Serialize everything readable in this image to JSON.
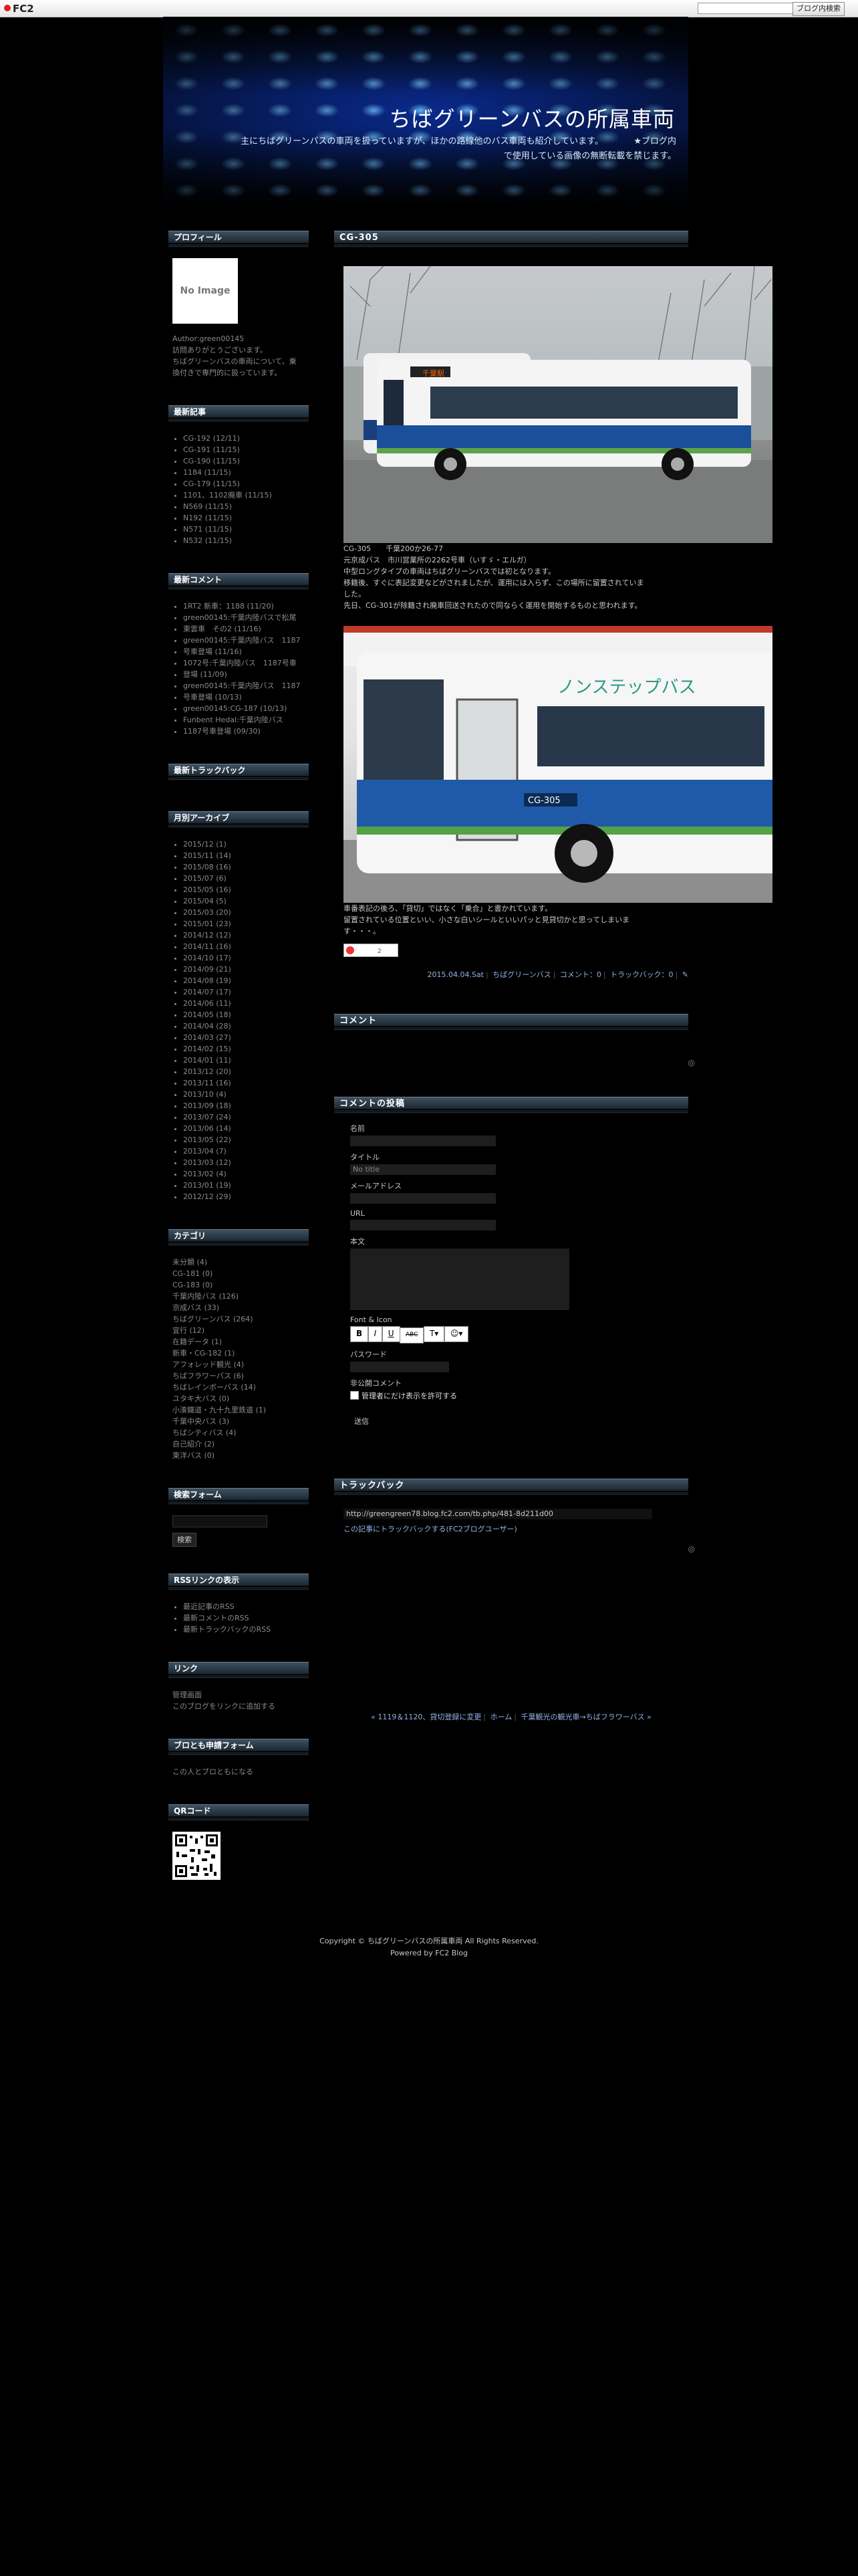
{
  "fc2bar": {
    "logo": "FC2",
    "search_button": "ブログ内検索"
  },
  "header": {
    "title": "ちばグリーンバスの所属車両",
    "desc_line1": "主にちばグリーンバスの車両を扱っていますが、ほかの路線他のバス車両も紹介しています。　　　　★ブログ内",
    "desc_line2": "で使用している画像の無断転載を禁じます。"
  },
  "sidebar": {
    "profile": {
      "title": "プロフィール",
      "image_text": "No Image",
      "author": "Author:green00145",
      "lines": [
        "訪問ありがとうございます。",
        "ちばグリーンバスの車両について、乗",
        "換付きで専門的に扱っています。"
      ]
    },
    "recent_entries": {
      "title": "最新記事",
      "items": [
        "CG-192 (12/11)",
        "CG-191 (11/15)",
        "CG-190 (11/15)",
        "1184 (11/15)",
        "CG-179 (11/15)",
        "1101、1102廃車 (11/15)",
        "N569 (11/15)",
        "N192 (11/15)",
        "N571 (11/15)",
        "N532 (11/15)"
      ]
    },
    "recent_comments": {
      "title": "最新コメント",
      "items": [
        "1RT2 新車：1188 (11/20)",
        "green00145:千葉内陸バスで松尾",
        "東雲車　その2 (11/16)",
        "green00145:千葉内陸バス　1187",
        "号車登場 (11/16)",
        "1072号:千葉内陸バス　1187号車",
        "登場 (11/09)",
        "green00145:千葉内陸バス　1187",
        "号車登場 (10/13)",
        "green00145:CG-187 (10/13)",
        "Funbent Hedal:千葉内陸バス",
        "1187号車登場 (09/30)"
      ]
    },
    "recent_trackbacks": {
      "title": "最新トラックバック"
    },
    "archives": {
      "title": "月別アーカイブ",
      "items": [
        "2015/12 (1)",
        "2015/11 (14)",
        "2015/08 (16)",
        "2015/07 (6)",
        "2015/05 (16)",
        "2015/04 (5)",
        "2015/03 (20)",
        "2015/01 (23)",
        "2014/12 (12)",
        "2014/11 (16)",
        "2014/10 (17)",
        "2014/09 (21)",
        "2014/08 (19)",
        "2014/07 (17)",
        "2014/06 (11)",
        "2014/05 (18)",
        "2014/04 (28)",
        "2014/03 (27)",
        "2014/02 (15)",
        "2014/01 (11)",
        "2013/12 (20)",
        "2013/11 (16)",
        "2013/10 (4)",
        "2013/09 (18)",
        "2013/07 (24)",
        "2013/06 (14)",
        "2013/05 (22)",
        "2013/04 (7)",
        "2013/03 (12)",
        "2013/02 (4)",
        "2013/01 (19)",
        "2012/12 (29)"
      ]
    },
    "categories": {
      "title": "カテゴリ",
      "items": [
        "未分類 (4)",
        "CG-181 (0)",
        "CG-183 (0)",
        "千葉内陸バス (126)",
        "京成バス (33)",
        "ちばグリーンバス (264)",
        "宜行 (12)",
        "在籍データ (1)",
        "新車・CG-182 (1)",
        "アフォレッド観光 (4)",
        "ちばフラワーバス (6)",
        "ちばレインボーバス (14)",
        "ユタキ大バス (0)",
        "小湊鐵道・九十九里鉄道 (1)",
        "千葉中央バス (3)",
        "ちばシティバス (4)",
        "自己紹介 (2)",
        "東洋バス (0)"
      ]
    },
    "search": {
      "title": "検索フォーム",
      "button": "検索"
    },
    "rss": {
      "title": "RSSリンクの表示",
      "items": [
        "最近記事のRSS",
        "最新コメントのRSS",
        "最新トラックバックのRSS"
      ]
    },
    "links": {
      "title": "リンク",
      "items": [
        "管理画面",
        "このブログをリンクに追加する"
      ]
    },
    "friend_form": {
      "title": "ブロとも申請フォーム",
      "text": "この人とブロともになる"
    },
    "qr": {
      "title": "QRコード"
    }
  },
  "entry": {
    "title": "CG-305",
    "caption1": [
      "CG-305　　千葉200か26-77",
      "元京成バス　市川営業所の2262号車（いすゞ・エルガ）",
      "中型ロングタイプの車両はちばグリーンバスでは初となります。",
      "移籍後、すぐに表記変更などがされましたが、運用には入らず、この場所に留置されていま",
      "した。",
      "先日、CG-301が除籍され廃車回送されたので同ならく運用を開始するものと思われます。"
    ],
    "caption2": [
      "車番表記の後ろ、「貸切」ではなく「乗合」と書かれています。",
      "留置されている位置といい、小さな白いシールといいパッと見貸切かと思ってしまいま",
      "す・・・。"
    ],
    "footer": {
      "date": "2015.04.04.Sat",
      "category": "ちばグリーンバス",
      "comments": "コメント：0",
      "trackbacks": "トラックバック：0",
      "edit": "✎"
    }
  },
  "comments": {
    "title": "コメント"
  },
  "post_comment": {
    "title": "コメントの投稿",
    "name_label": "名前",
    "subject_label": "タイトル",
    "subject_value": "No title",
    "email_label": "メールアドレス",
    "url_label": "URL",
    "body_label": "本文",
    "font_icon_label": "Font & Icon",
    "tools": [
      "B",
      "I",
      "U",
      "ABC",
      "T▾",
      "☺▾"
    ],
    "password_label": "パスワード",
    "private_label": "非公開コメント",
    "private_checkbox": "管理者にだけ表示を許可する",
    "submit": "送信"
  },
  "trackback": {
    "title": "トラックバック",
    "url": "http://greengreen78.blog.fc2.com/tb.php/481-8d211d00",
    "link": "この記事にトラックバックする(FC2ブログユーザー)"
  },
  "pager": {
    "prev": "« 1119＆1120、貸切登録に変更",
    "home": "ホーム",
    "next": "千葉観光の観光車→ちばフラワーバス »"
  },
  "footer": {
    "copyright": "Copyright © ちばグリーンバスの所属車両 All Rights Reserved.",
    "powered": "Powered by FC2 Blog"
  },
  "bus_texts": {
    "dest1": "千葉駅",
    "num2": "CG-305",
    "sign2": "ノンステップバス"
  }
}
